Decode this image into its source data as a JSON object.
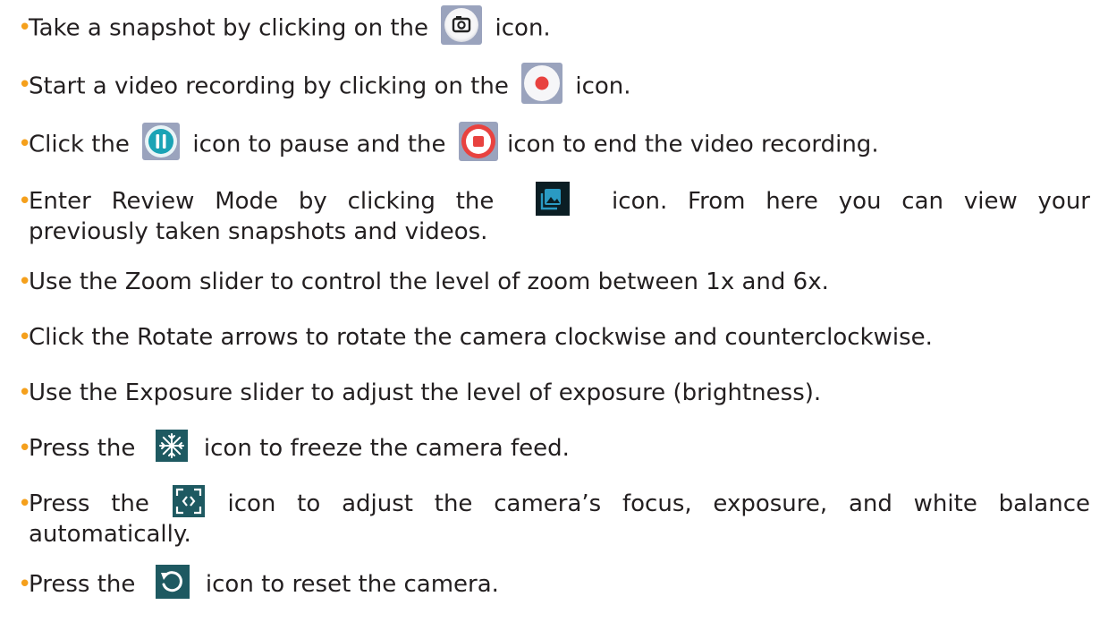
{
  "bullets": [
    {
      "before": "Take a snapshot by clicking on the",
      "icon": "camera-icon",
      "after": "icon."
    },
    {
      "before": "Start a video recording by clicking on the",
      "icon": "record-icon",
      "after": "icon."
    },
    {
      "before": "Click the",
      "icon": "pause-icon",
      "middle": "icon to pause and the",
      "icon2": "stop-icon",
      "after": "icon to end the video recording."
    },
    {
      "before": "Enter Review Mode by clicking the",
      "icon": "gallery-icon",
      "after": "icon. From here you can view your",
      "line2": "previously taken snapshots and videos."
    },
    {
      "text": "Use the Zoom slider to control the level of zoom between 1x and 6x."
    },
    {
      "text": "Click the Rotate arrows to rotate the camera clockwise and counterclockwise."
    },
    {
      "text": "Use the Exposure slider to adjust the level of exposure (brightness)."
    },
    {
      "before": "Press the",
      "icon": "snowflake-icon",
      "after": "icon to freeze the camera feed."
    },
    {
      "before": "Press the",
      "icon": "auto-focus-icon",
      "after": "icon to adjust the camera’s focus, exposure, and white balance",
      "line2": "automatically."
    },
    {
      "before": "Press the",
      "icon": "reset-icon",
      "after": "icon to reset the camera."
    }
  ],
  "colors": {
    "bullet": "#f5a01c",
    "text": "#231f20",
    "icon_teal": "#1e5961",
    "record_red": "#e8423f",
    "pause_teal": "#1aa3b5"
  }
}
